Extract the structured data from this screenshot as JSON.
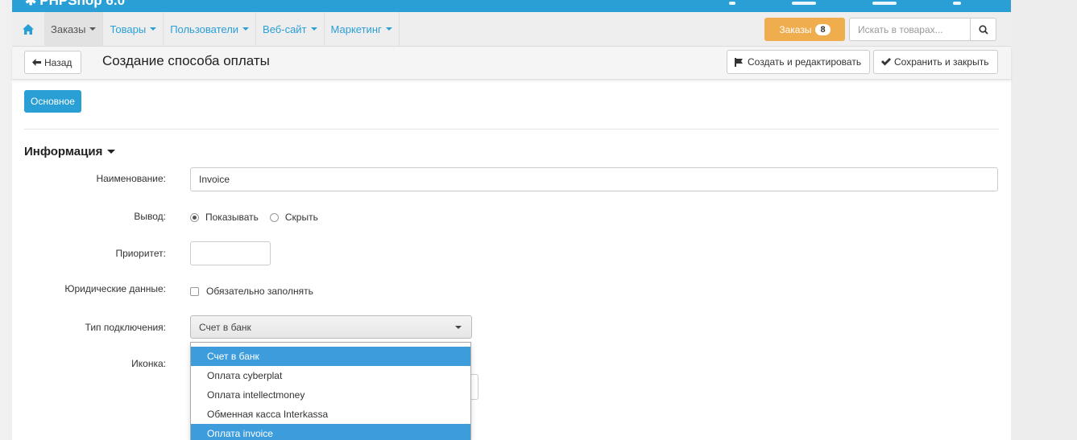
{
  "brand": {
    "title": "PHPShop 6.0"
  },
  "nav": {
    "items": [
      {
        "label": "Заказы",
        "active": true
      },
      {
        "label": "Товары"
      },
      {
        "label": "Пользователи"
      },
      {
        "label": "Веб-сайт"
      },
      {
        "label": "Маркетинг"
      }
    ],
    "orders_button": {
      "label": "Заказы",
      "badge": "8"
    },
    "search": {
      "placeholder": "Искать в товарах..."
    }
  },
  "actionbar": {
    "back_label": "Назад",
    "page_title": "Создание способа оплаты",
    "create_edit_label": "Создать и редактировать",
    "save_close_label": "Сохранить и закрыть"
  },
  "tabs": {
    "main_label": "Основное"
  },
  "form": {
    "section_title": "Информация",
    "name": {
      "label": "Наименование:",
      "value": "Invoice"
    },
    "output": {
      "label": "Вывод:",
      "option_show": "Показывать",
      "option_hide": "Скрыть",
      "selected": "Показывать"
    },
    "priority": {
      "label": "Приоритет:",
      "value": ""
    },
    "legal": {
      "label": "Юридические данные:",
      "checkbox_label": "Обязательно заполнять",
      "checked": false
    },
    "connection": {
      "label": "Тип подключения:",
      "selected": "Счет в банк",
      "options": [
        "Счет в банк",
        "Оплата cyberplat",
        "Оплата intellectmoney",
        "Обменная касса Interkassa",
        "Оплата invoice"
      ],
      "highlighted": [
        "Счет в банк",
        "Оплата invoice"
      ]
    },
    "icon": {
      "label": "Иконка:"
    }
  },
  "colors": {
    "primary": "#2a9fd6",
    "warning": "#f0ad4e",
    "highlight": "#3d9ddc"
  }
}
